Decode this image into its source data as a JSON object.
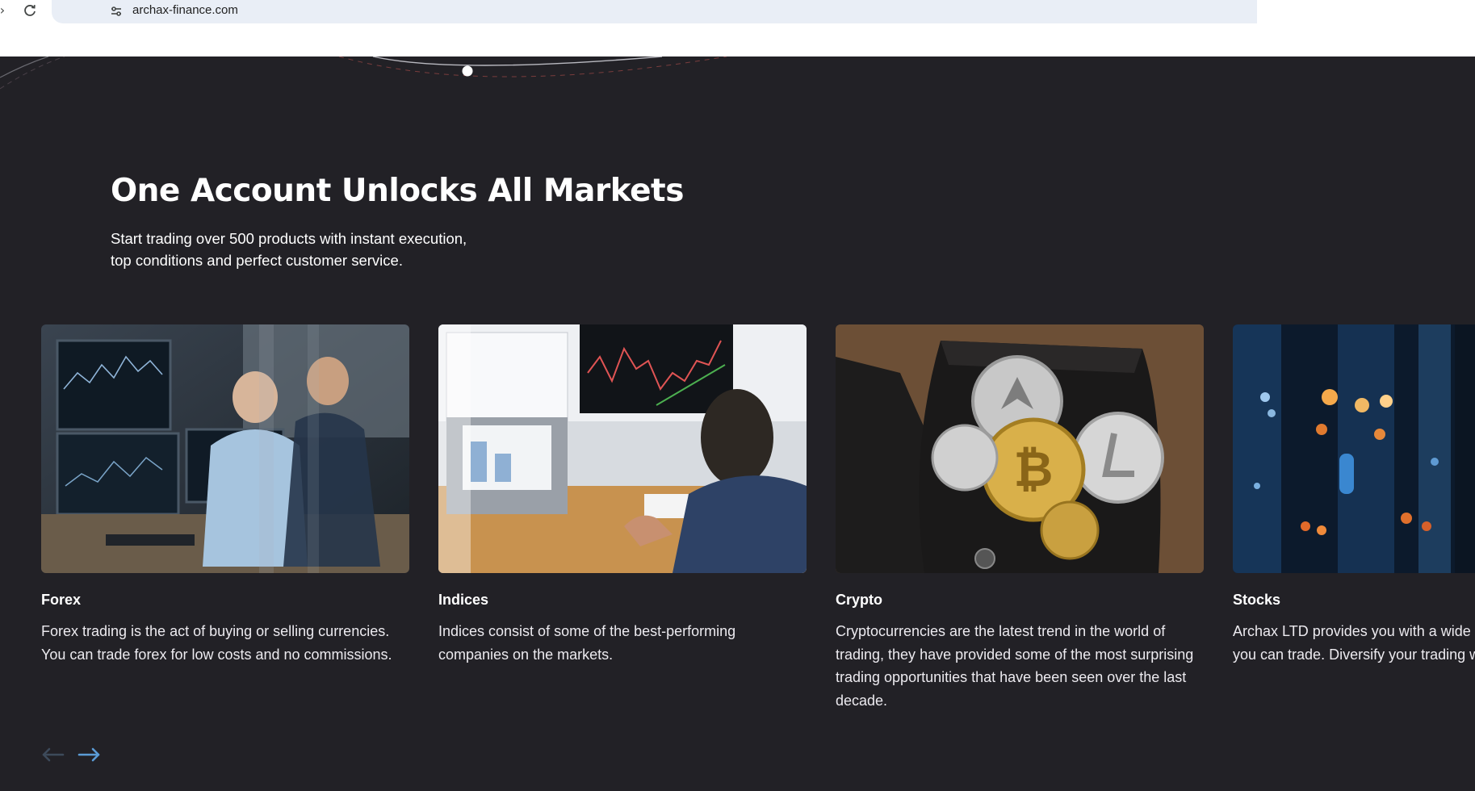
{
  "browser": {
    "url": "archax-finance.com"
  },
  "section": {
    "headline": "One Account Unlocks All Markets",
    "subtitle_line1": "Start trading over 500 products with instant execution,",
    "subtitle_line2": "top conditions and perfect customer service."
  },
  "cards": [
    {
      "title": "Forex",
      "description": "Forex trading is the act of buying or selling currencies. You can trade forex for low costs and no commissions."
    },
    {
      "title": "Indices",
      "description": "Indices consist of some of the best-performing companies on the markets."
    },
    {
      "title": "Crypto",
      "description": "Cryptocurrencies are the latest trend in the world of trading, they have provided some of the most surprising trading opportunities that have been seen over the last decade."
    },
    {
      "title": "Stocks",
      "description": "Archax LTD provides you with a wide selection of stocks you can trade. Diversify your trading with ease."
    }
  ],
  "carousel": {
    "prev_icon": "arrow-left-icon",
    "next_icon": "arrow-right-icon"
  },
  "colors": {
    "page_background": "#222126",
    "headline": "#ffffff",
    "arrow_active": "#5b9cd6",
    "arrow_inactive": "#3d4a5a"
  }
}
